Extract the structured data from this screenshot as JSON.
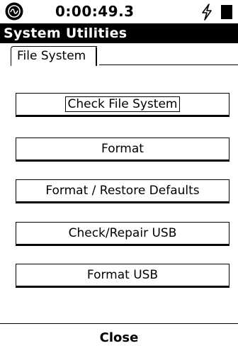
{
  "status_bar": {
    "device_icon": "device-status-icon",
    "elapsed_time": "0:00:49.3",
    "power_icon": "lightning-bolt-icon",
    "battery_icon": "battery-icon"
  },
  "window": {
    "title": "System Utilities"
  },
  "tabs": [
    {
      "label": "File System",
      "active": true
    }
  ],
  "actions": [
    {
      "label": "Check File System",
      "focused": true
    },
    {
      "label": "Format",
      "focused": false
    },
    {
      "label": "Format / Restore Defaults",
      "focused": false
    },
    {
      "label": "Check/Repair USB",
      "focused": false
    },
    {
      "label": "Format USB",
      "focused": false
    }
  ],
  "footer": {
    "close_label": "Close"
  },
  "colors": {
    "background": "#ffffff",
    "foreground": "#000000",
    "title_bar_bg": "#000000",
    "title_bar_fg": "#ffffff"
  }
}
